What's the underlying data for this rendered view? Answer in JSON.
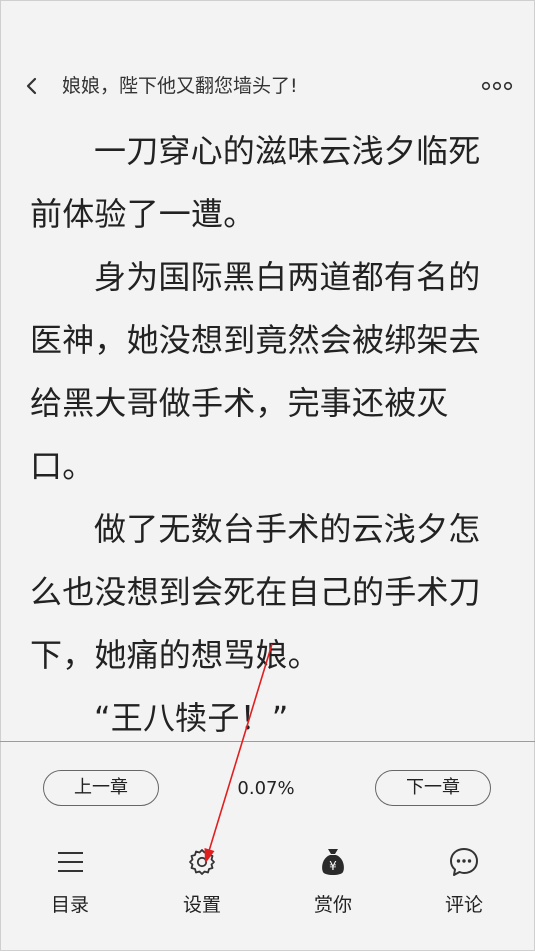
{
  "header": {
    "title": "娘娘，陛下他又翻您墙头了!",
    "back_icon": "chevron-left-icon",
    "more_icon": "more-dots-icon"
  },
  "article": {
    "paragraphs": [
      "一刀穿心的滋味云浅夕临死前体验了一遭。",
      "身为国际黑白两道都有名的医神，她没想到竟然会被绑架去给黑大哥做手术，完事还被灭口。",
      "做了无数台手术的云浅夕怎么也没想到会死在自己的手术刀下，她痛的想骂娘。",
      "“王八犊子！”"
    ]
  },
  "nav": {
    "prev_label": "上一章",
    "next_label": "下一章",
    "progress": "0.07%"
  },
  "toolbar": [
    {
      "label": "目录",
      "icon": "menu-list-icon"
    },
    {
      "label": "设置",
      "icon": "gear-icon"
    },
    {
      "label": "赏你",
      "icon": "money-bag-icon"
    },
    {
      "label": "评论",
      "icon": "comment-icon"
    }
  ],
  "annotation": {
    "type": "arrow",
    "color": "#e02020"
  }
}
